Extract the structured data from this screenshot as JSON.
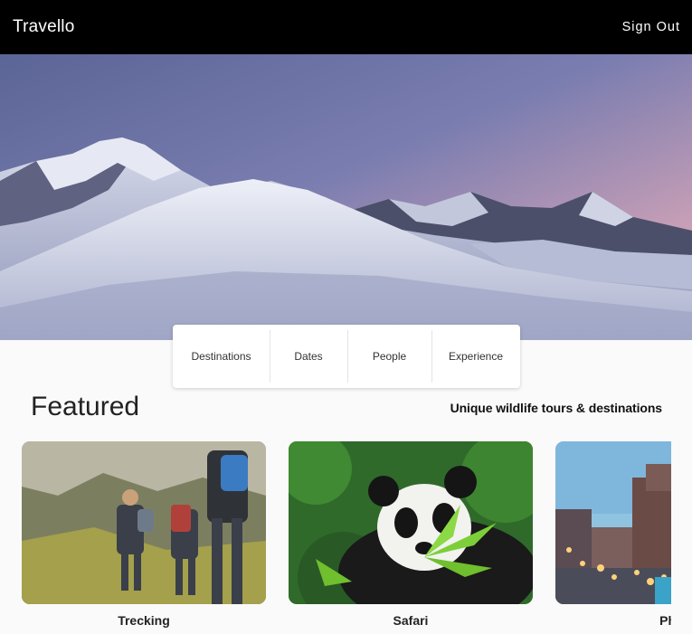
{
  "app": {
    "title": "Travello",
    "sign_out_label": "Sign Out"
  },
  "search": {
    "segments": [
      "Destinations",
      "Dates",
      "People",
      "Experience"
    ]
  },
  "featured": {
    "title": "Featured",
    "subtitle": "Unique wildlife tours & destinations",
    "cards": [
      {
        "label": "Trecking",
        "image": "hikers-image"
      },
      {
        "label": "Safari",
        "image": "panda-image"
      },
      {
        "label": "Photo",
        "image": "city-street-image"
      }
    ]
  }
}
